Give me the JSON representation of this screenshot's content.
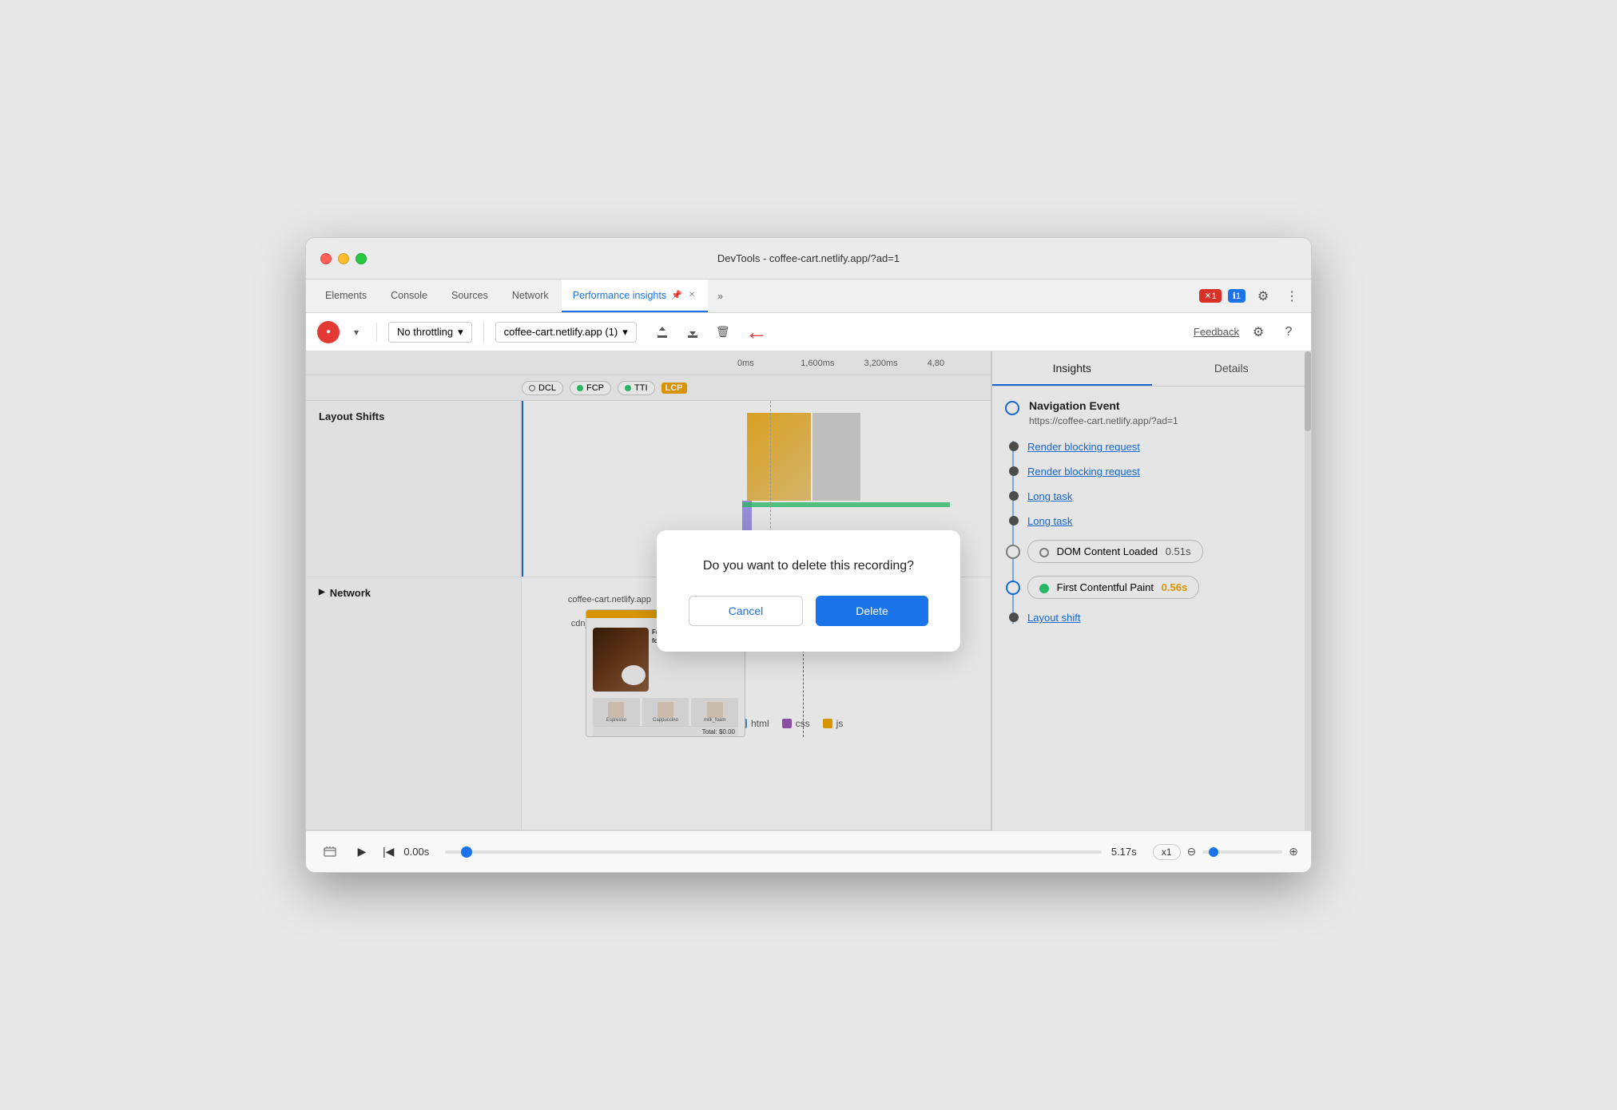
{
  "window": {
    "title": "DevTools - coffee-cart.netlify.app/?ad=1"
  },
  "titlebar": {
    "close": "close",
    "minimize": "minimize",
    "maximize": "maximize"
  },
  "tabs": {
    "items": [
      {
        "label": "Elements",
        "active": false
      },
      {
        "label": "Console",
        "active": false
      },
      {
        "label": "Sources",
        "active": false
      },
      {
        "label": "Network",
        "active": false
      },
      {
        "label": "Performance insights",
        "active": true
      }
    ],
    "more": "»",
    "badge_error": "1",
    "badge_info": "1"
  },
  "toolbar": {
    "throttle_label": "No throttling",
    "url_label": "coffee-cart.netlify.app (1)",
    "feedback_label": "Feedback"
  },
  "timeline": {
    "time_marks": [
      "0ms",
      "1,600ms",
      "3,200ms",
      "4,80"
    ],
    "markers": {
      "dcl": "DCL",
      "fcp": "FCP",
      "tti": "TTI",
      "lcp": "LCP"
    },
    "sections": {
      "layout_shifts_label": "Layout Shifts",
      "network_label": "Network"
    },
    "network_items": [
      {
        "label": "coffee-cart.netlify.app"
      },
      {
        "label": "cdnjs.cloudflare.com"
      }
    ],
    "legend": [
      {
        "label": "html",
        "color": "#4a90d9"
      },
      {
        "label": "css",
        "color": "#9b59b6"
      },
      {
        "label": "js",
        "color": "#f0a500"
      }
    ]
  },
  "right_panel": {
    "tabs": [
      "Insights",
      "Details"
    ],
    "active_tab": "Insights",
    "insights": {
      "nav_event_title": "Navigation Event",
      "nav_event_url": "https://coffee-cart.netlify.app/?ad=1",
      "items": [
        {
          "label": "Render blocking request",
          "type": "link"
        },
        {
          "label": "Render blocking request",
          "type": "link"
        },
        {
          "label": "Long task",
          "type": "link"
        },
        {
          "label": "Long task",
          "type": "link"
        },
        {
          "label": "DOM Content Loaded",
          "value": "0.51s",
          "type": "metric"
        },
        {
          "label": "First Contentful Paint",
          "value": "0.56s",
          "type": "fcp"
        },
        {
          "label": "Layout shift",
          "type": "link"
        }
      ]
    }
  },
  "dialog": {
    "message": "Do you want to delete this recording?",
    "cancel_label": "Cancel",
    "delete_label": "Delete"
  },
  "bottom_bar": {
    "time_start": "0.00s",
    "time_end": "5.17s",
    "zoom_level": "x1"
  }
}
